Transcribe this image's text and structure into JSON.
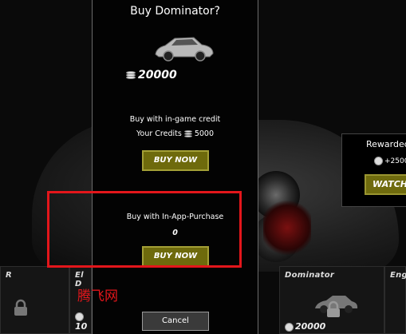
{
  "modal": {
    "title": "Buy Dominator?",
    "price": "20000",
    "ingame_label": "Buy with in-game credit",
    "credits_label": "Your Credits",
    "credits_value": "5000",
    "buy_now_label": "BUY NOW",
    "iap_label": "Buy with In-App-Purchase",
    "iap_price": "0",
    "iap_buy_label": "BUY NOW",
    "cancel_label": "Cancel"
  },
  "right_panel": {
    "title": "Rewarded",
    "reward": "+2500",
    "watch_label": "WATCH A"
  },
  "car_cards": [
    {
      "name": "R",
      "price": ""
    },
    {
      "name": "El D",
      "price": "10"
    },
    {
      "name": "Dominator",
      "price": "20000"
    },
    {
      "name": "Eng",
      "price": ""
    }
  ],
  "watermark": "腾飞网",
  "colors": {
    "button_fill": "#6e6a0c",
    "button_border": "#a39f36",
    "highlight": "#e3161b",
    "modal_bg": "#030303"
  }
}
